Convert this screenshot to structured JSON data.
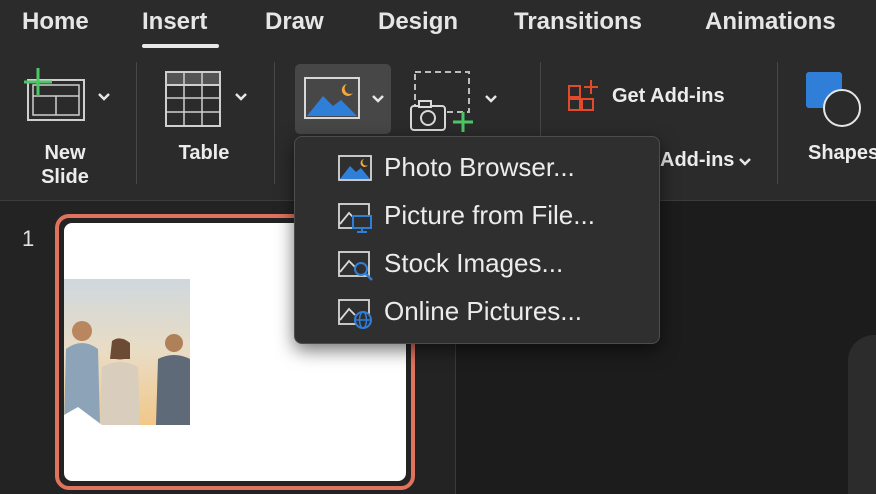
{
  "tabs": [
    {
      "label": "Home"
    },
    {
      "label": "Insert",
      "active": true
    },
    {
      "label": "Draw"
    },
    {
      "label": "Design"
    },
    {
      "label": "Transitions"
    },
    {
      "label": "Animations"
    }
  ],
  "ribbon": {
    "new_slide_line1": "New",
    "new_slide_line2": "Slide",
    "table": "Table",
    "get_addins": "Get Add-ins",
    "my_addins_partial": "Add-ins",
    "shapes_partial": "Shapes"
  },
  "pictures_menu": {
    "items": [
      {
        "label": "Photo Browser...",
        "icon": "photo-browser-icon"
      },
      {
        "label": "Picture from File...",
        "icon": "picture-from-file-icon"
      },
      {
        "label": "Stock Images...",
        "icon": "stock-images-icon"
      },
      {
        "label": "Online Pictures...",
        "icon": "online-pictures-icon"
      }
    ]
  },
  "slides": {
    "number": "1"
  },
  "colors": {
    "accent_selection": "#e0735e",
    "icon_blue": "#2f7fd9",
    "icon_green": "#4cc764",
    "icon_orange": "#e24a2b"
  }
}
